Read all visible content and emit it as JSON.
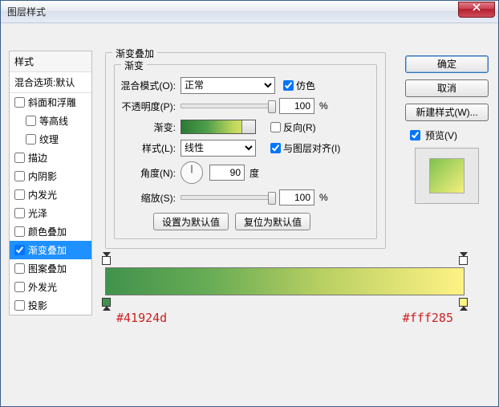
{
  "window": {
    "title": "图层样式"
  },
  "styles_panel": {
    "header": "样式",
    "blend_options": "混合选项:默认",
    "items": [
      {
        "label": "斜面和浮雕",
        "checked": false,
        "indent": false
      },
      {
        "label": "等高线",
        "checked": false,
        "indent": true
      },
      {
        "label": "纹理",
        "checked": false,
        "indent": true
      },
      {
        "label": "描边",
        "checked": false,
        "indent": false
      },
      {
        "label": "内阴影",
        "checked": false,
        "indent": false
      },
      {
        "label": "内发光",
        "checked": false,
        "indent": false
      },
      {
        "label": "光泽",
        "checked": false,
        "indent": false
      },
      {
        "label": "颜色叠加",
        "checked": false,
        "indent": false
      },
      {
        "label": "渐变叠加",
        "checked": true,
        "indent": false,
        "selected": true
      },
      {
        "label": "图案叠加",
        "checked": false,
        "indent": false
      },
      {
        "label": "外发光",
        "checked": false,
        "indent": false
      },
      {
        "label": "投影",
        "checked": false,
        "indent": false
      }
    ]
  },
  "gradient_overlay": {
    "group_title": "渐变叠加",
    "sub_title": "渐变",
    "blend_mode": {
      "label": "混合模式(O):",
      "value": "正常"
    },
    "dither": {
      "label": "仿色",
      "checked": true
    },
    "opacity": {
      "label": "不透明度(P):",
      "value": "100",
      "unit": "%"
    },
    "gradient": {
      "label": "渐变:"
    },
    "reverse": {
      "label": "反向(R)",
      "checked": false
    },
    "style": {
      "label": "样式(L):",
      "value": "线性"
    },
    "align": {
      "label": "与图层对齐(I)",
      "checked": true
    },
    "angle": {
      "label": "角度(N):",
      "value": "90",
      "unit": "度"
    },
    "scale": {
      "label": "缩放(S):",
      "value": "100",
      "unit": "%"
    },
    "btn_default": "设置为默认值",
    "btn_reset": "复位为默认值"
  },
  "gradient_stops": {
    "left_hex": "#41924d",
    "right_hex": "#fff285"
  },
  "buttons": {
    "ok": "确定",
    "cancel": "取消",
    "new_style": "新建样式(W)...",
    "preview": "预览(V)"
  }
}
